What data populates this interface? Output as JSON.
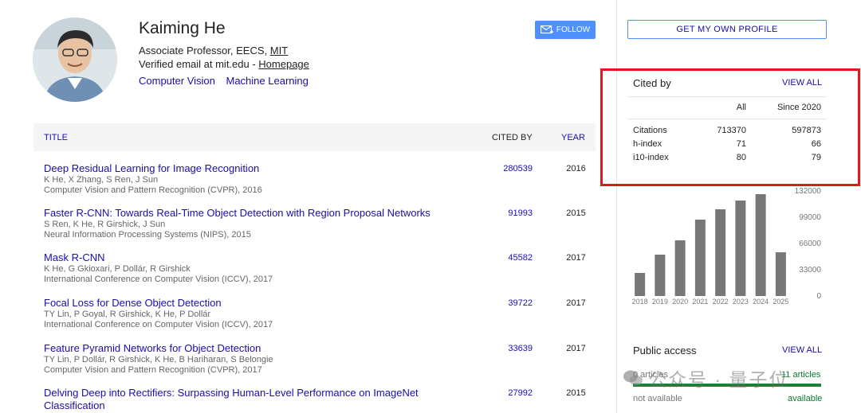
{
  "profile": {
    "name": "Kaiming He",
    "affiliation_prefix": "Associate Professor, EECS, ",
    "affiliation_link": "MIT",
    "email_prefix": "Verified email at mit.edu - ",
    "homepage_label": "Homepage",
    "interests": [
      "Computer Vision",
      "Machine Learning"
    ],
    "follow_label": "FOLLOW",
    "avatar_icon": "person-photo"
  },
  "table": {
    "headers": {
      "title": "TITLE",
      "cited_by": "CITED BY",
      "year": "YEAR"
    },
    "rows": [
      {
        "title": "Deep Residual Learning for Image Recognition",
        "authors": "K He, X Zhang, S Ren, J Sun",
        "venue": "Computer Vision and Pattern Recognition (CVPR), 2016",
        "cited_by": "280539",
        "year": "2016"
      },
      {
        "title": "Faster R-CNN: Towards Real-Time Object Detection with Region Proposal Networks",
        "authors": "S Ren, K He, R Girshick, J Sun",
        "venue": "Neural Information Processing Systems (NIPS), 2015",
        "cited_by": "91993",
        "year": "2015"
      },
      {
        "title": "Mask R-CNN",
        "authors": "K He, G Gkioxari, P Dollár, R Girshick",
        "venue": "International Conference on Computer Vision (ICCV), 2017",
        "cited_by": "45582",
        "year": "2017"
      },
      {
        "title": "Focal Loss for Dense Object Detection",
        "authors": "TY Lin, P Goyal, R Girshick, K He, P Dollár",
        "venue": "International Conference on Computer Vision (ICCV), 2017",
        "cited_by": "39722",
        "year": "2017"
      },
      {
        "title": "Feature Pyramid Networks for Object Detection",
        "authors": "TY Lin, P Dollár, R Girshick, K He, B Hariharan, S Belongie",
        "venue": "Computer Vision and Pattern Recognition (CVPR), 2017",
        "cited_by": "33639",
        "year": "2017"
      },
      {
        "title": "Delving Deep into Rectifiers: Surpassing Human-Level Performance on ImageNet Classification",
        "authors": "",
        "venue": "",
        "cited_by": "27992",
        "year": "2015"
      }
    ]
  },
  "sidebar": {
    "own_profile_label": "GET MY OWN PROFILE",
    "cited_by": {
      "title": "Cited by",
      "view_all": "VIEW ALL",
      "col_all": "All",
      "col_since": "Since 2020",
      "metrics": [
        {
          "label": "Citations",
          "all": "713370",
          "since": "597873"
        },
        {
          "label": "h-index",
          "all": "71",
          "since": "66"
        },
        {
          "label": "i10-index",
          "all": "80",
          "since": "79"
        }
      ]
    },
    "public_access": {
      "title": "Public access",
      "view_all": "VIEW ALL",
      "left_count": "0 articles",
      "right_count": "11 articles",
      "left_label": "not available",
      "right_label": "available",
      "available_fraction": 1.0
    }
  },
  "chart_data": {
    "type": "bar",
    "categories": [
      "2018",
      "2019",
      "2020",
      "2021",
      "2022",
      "2023",
      "2024",
      "2025"
    ],
    "values": [
      29000,
      52000,
      70000,
      96000,
      109000,
      120000,
      128000,
      55000
    ],
    "ylim": [
      0,
      132000
    ],
    "yticks": [
      "132000",
      "99000",
      "66000",
      "33000",
      "0"
    ],
    "ytick_values": [
      132000,
      99000,
      66000,
      33000,
      0
    ],
    "bar_color": "#777777",
    "grid": false
  },
  "watermark": {
    "text": "公众号 · 量子位"
  },
  "colors": {
    "link": "#1a0dab",
    "accent_button": "#4d90fe",
    "highlight_box": "#e0191e",
    "available_green": "#1e7e34"
  }
}
